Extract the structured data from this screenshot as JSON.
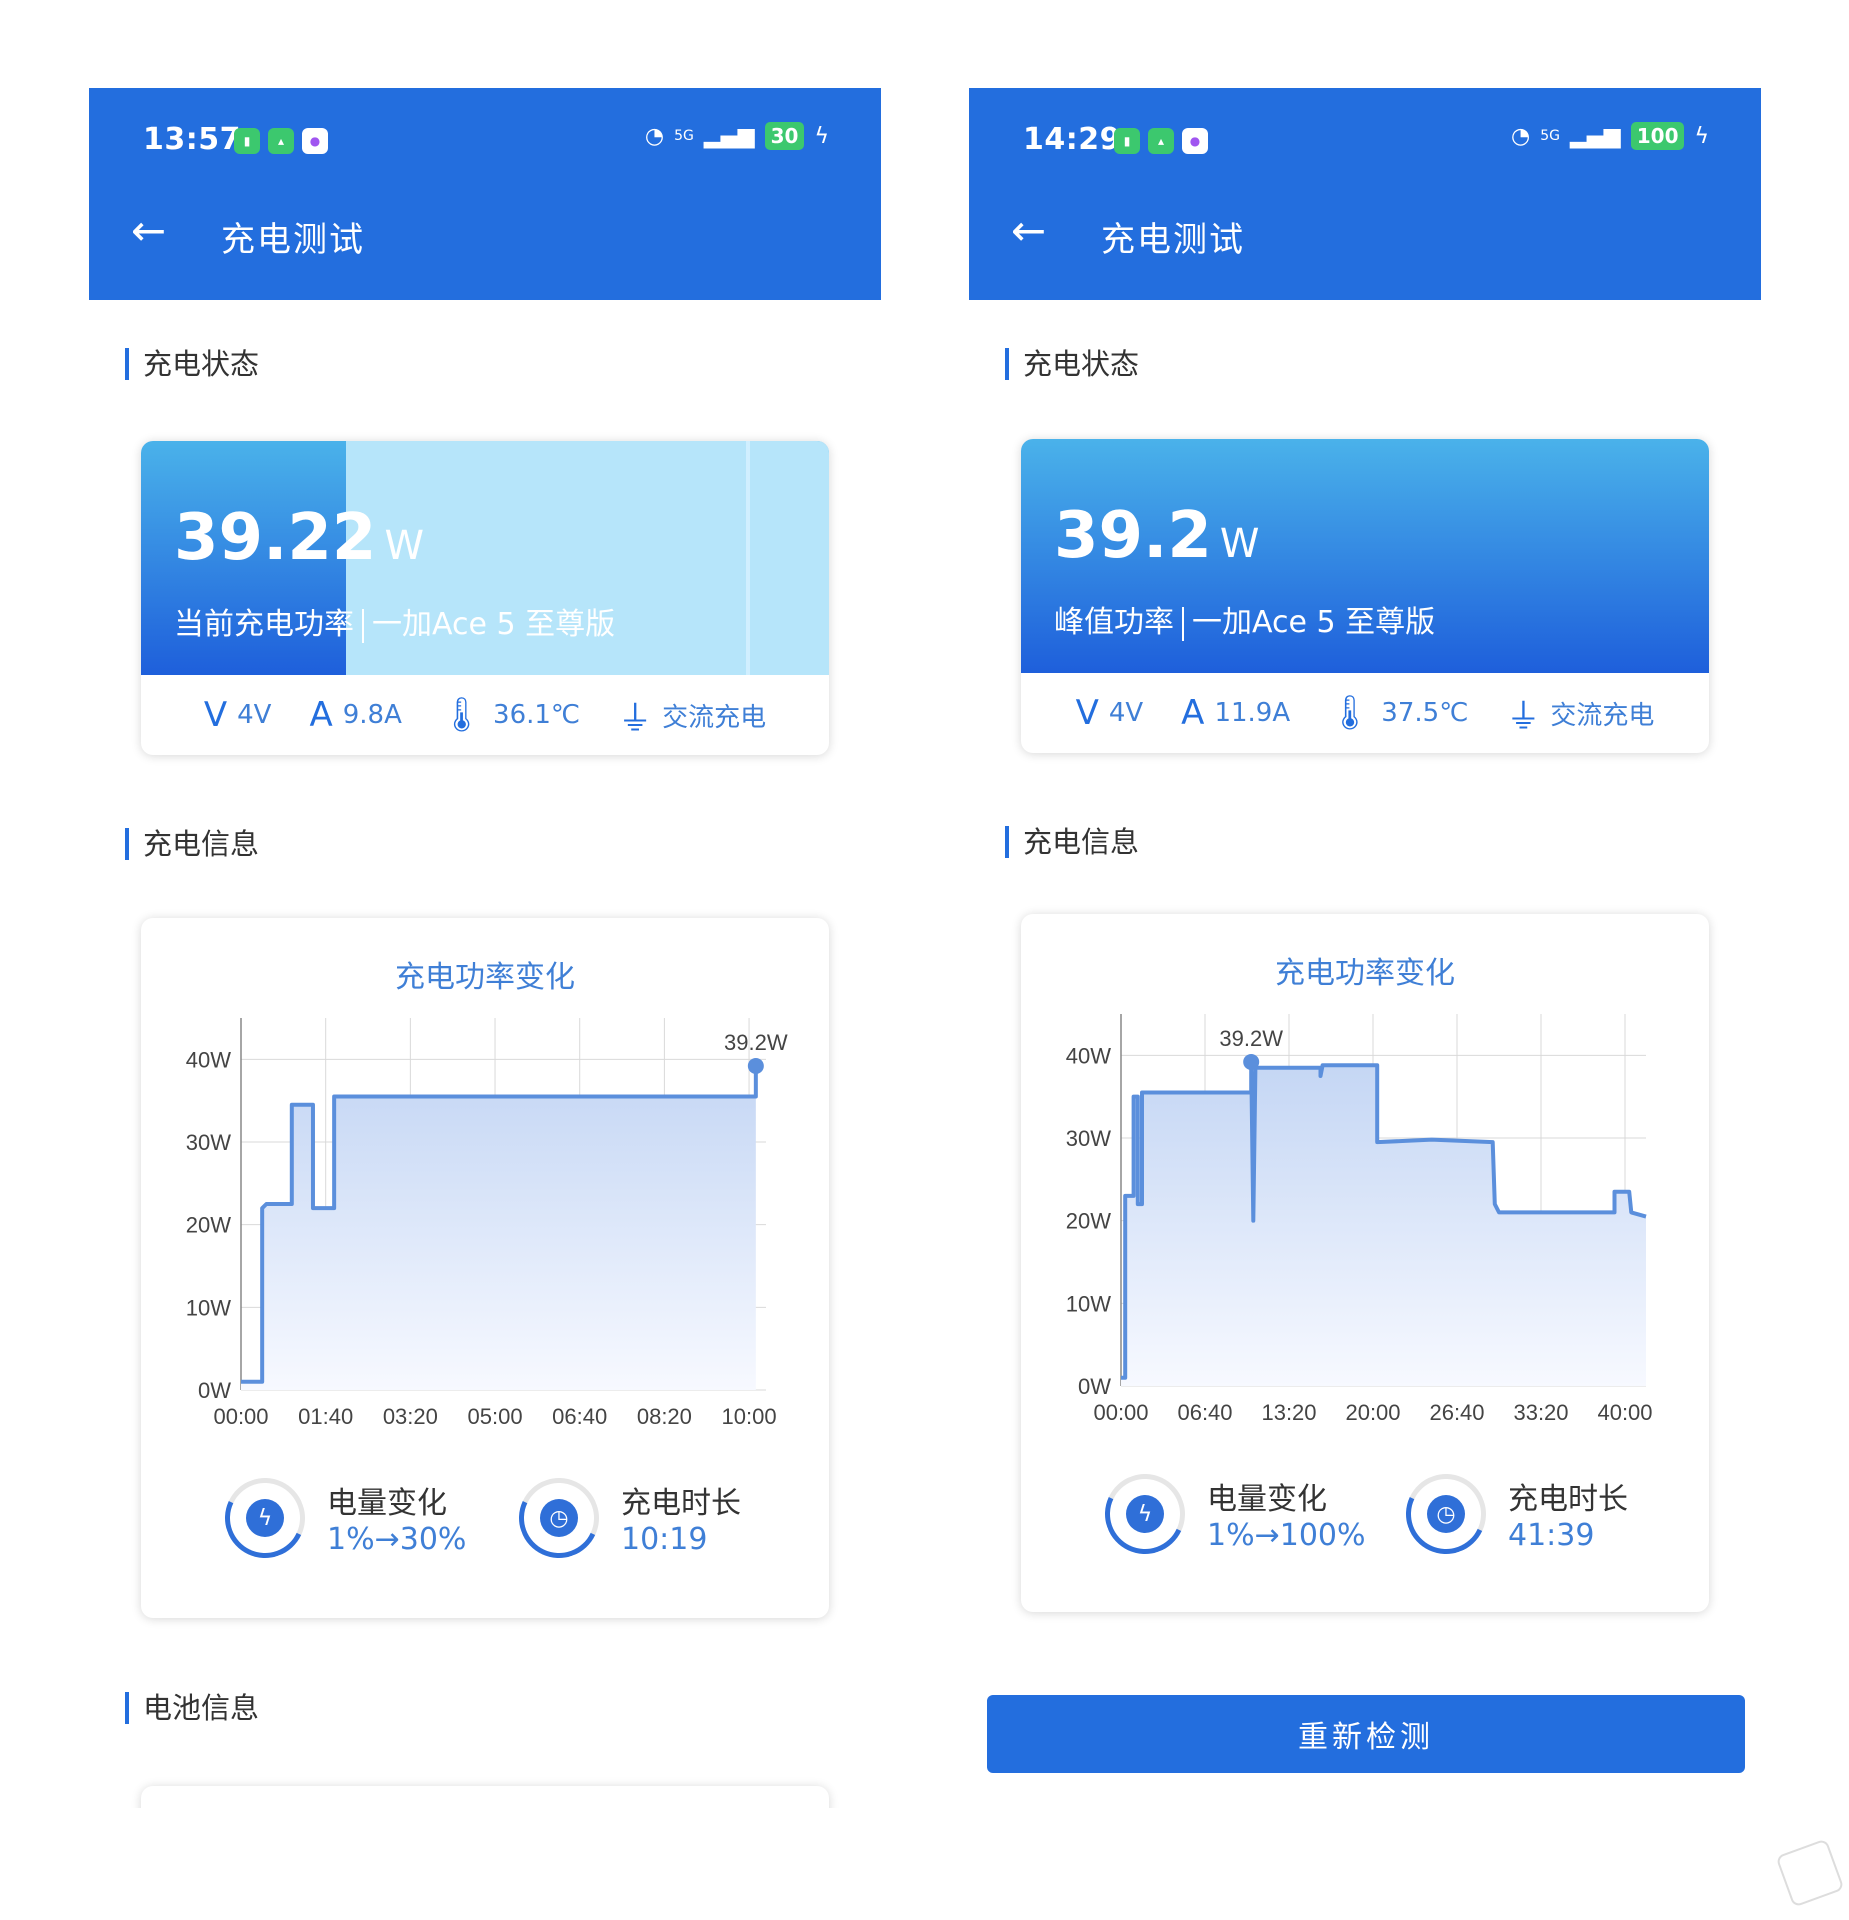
{
  "colors": {
    "accent": "#236ede",
    "line": "#5b8fdc",
    "value_text": "#3f7fd6"
  },
  "left": {
    "status_bar": {
      "time": "13:57",
      "network": "5G",
      "battery": "30"
    },
    "app_title": "充电测试",
    "section_status": "充电状态",
    "power_value": "39.22",
    "power_unit": "W",
    "power_label": "当前充电功率",
    "device": "一加Ace 5 至尊版",
    "voltage": "4V",
    "current": "9.8A",
    "temperature": "36.1℃",
    "charge_type": "交流充电",
    "section_info": "充电信息",
    "chart_title": "充电功率变化",
    "battery_change_label": "电量变化",
    "battery_change_value": "1%→30%",
    "duration_label": "充电时长",
    "duration_value": "10:19",
    "section_battery": "电池信息"
  },
  "right": {
    "status_bar": {
      "time": "14:29",
      "network": "5G",
      "battery": "100"
    },
    "app_title": "充电测试",
    "section_status": "充电状态",
    "power_value": "39.2",
    "power_unit": "W",
    "power_label": "峰值功率",
    "device": "一加Ace 5 至尊版",
    "voltage": "4V",
    "current": "11.9A",
    "temperature": "37.5℃",
    "charge_type": "交流充电",
    "section_info": "充电信息",
    "chart_title": "充电功率变化",
    "battery_change_label": "电量变化",
    "battery_change_value": "1%→100%",
    "duration_label": "充电时长",
    "duration_value": "41:39",
    "recheck_button": "重新检测"
  },
  "chart_data": [
    {
      "type": "line",
      "title": "充电功率变化",
      "y_ticks": [
        "0W",
        "10W",
        "20W",
        "30W",
        "40W"
      ],
      "x_ticks": [
        "00:00",
        "01:40",
        "03:20",
        "05:00",
        "06:40",
        "08:20",
        "10:00"
      ],
      "ylim": [
        0,
        45
      ],
      "xlim_seconds": [
        0,
        620
      ],
      "annotation": "39.2W",
      "points": [
        [
          0,
          1
        ],
        [
          25,
          1
        ],
        [
          25,
          22
        ],
        [
          30,
          22.5
        ],
        [
          60,
          22.5
        ],
        [
          60,
          34.5
        ],
        [
          85,
          34.5
        ],
        [
          85,
          22
        ],
        [
          110,
          22
        ],
        [
          110,
          35.5
        ],
        [
          608,
          35.5
        ],
        [
          608,
          39.2
        ]
      ]
    },
    {
      "type": "line",
      "title": "充电功率变化",
      "y_ticks": [
        "0W",
        "10W",
        "20W",
        "30W",
        "40W"
      ],
      "x_ticks": [
        "00:00",
        "06:40",
        "13:20",
        "20:00",
        "26:40",
        "33:20",
        "40:00"
      ],
      "ylim": [
        0,
        45
      ],
      "xlim_seconds": [
        0,
        2500
      ],
      "annotation": "39.2W",
      "points": [
        [
          0,
          1
        ],
        [
          20,
          1
        ],
        [
          20,
          23
        ],
        [
          60,
          23
        ],
        [
          60,
          35
        ],
        [
          80,
          35
        ],
        [
          80,
          22
        ],
        [
          100,
          22
        ],
        [
          100,
          35.5
        ],
        [
          620,
          35.5
        ],
        [
          620,
          39.2
        ],
        [
          630,
          20
        ],
        [
          640,
          38.5
        ],
        [
          950,
          38.5
        ],
        [
          950,
          37.5
        ],
        [
          960,
          38.8
        ],
        [
          1220,
          38.8
        ],
        [
          1220,
          29.5
        ],
        [
          1480,
          29.8
        ],
        [
          1770,
          29.5
        ],
        [
          1780,
          22
        ],
        [
          1800,
          21
        ],
        [
          2350,
          21
        ],
        [
          2350,
          23.5
        ],
        [
          2420,
          23.5
        ],
        [
          2430,
          21
        ],
        [
          2500,
          20.5
        ]
      ]
    }
  ]
}
